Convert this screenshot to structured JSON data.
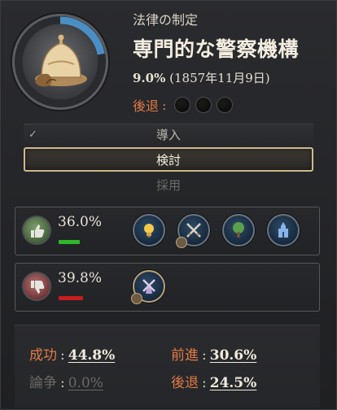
{
  "header": {
    "subtitle": "法律の制定",
    "title": "専門的な警察機構",
    "progress_pct": "9.0%",
    "progress_date": "(1857年11月9日)",
    "progress_value": 0.09,
    "regress_label": "後退",
    "regress_colon": ":",
    "regress_dots": 3
  },
  "steps": {
    "introduced": "導入",
    "debating": "検討",
    "adopted": "採用",
    "check_icon": "✓"
  },
  "support": {
    "pct": "36.0%",
    "icon": "thumbs-up-icon",
    "groups": [
      "lightbulb-icon",
      "crossed-swords-icon",
      "tree-icon",
      "church-icon"
    ]
  },
  "oppose": {
    "pct": "39.8%",
    "icon": "thumbs-down-icon",
    "groups": [
      "windmill-icon"
    ]
  },
  "stats": {
    "success_label": "成功",
    "success_value": "44.8%",
    "advance_label": "前進",
    "advance_value": "30.6%",
    "debate_label": "論争",
    "debate_value": "0.0%",
    "regress_label": "後退",
    "regress_value": "24.5%",
    "colon": ":"
  },
  "colors": {
    "accent_orange": "#e07a45",
    "support_green": "#2fb82a",
    "oppose_red": "#c51d1d",
    "progress_blue": "#4a8fc4"
  }
}
